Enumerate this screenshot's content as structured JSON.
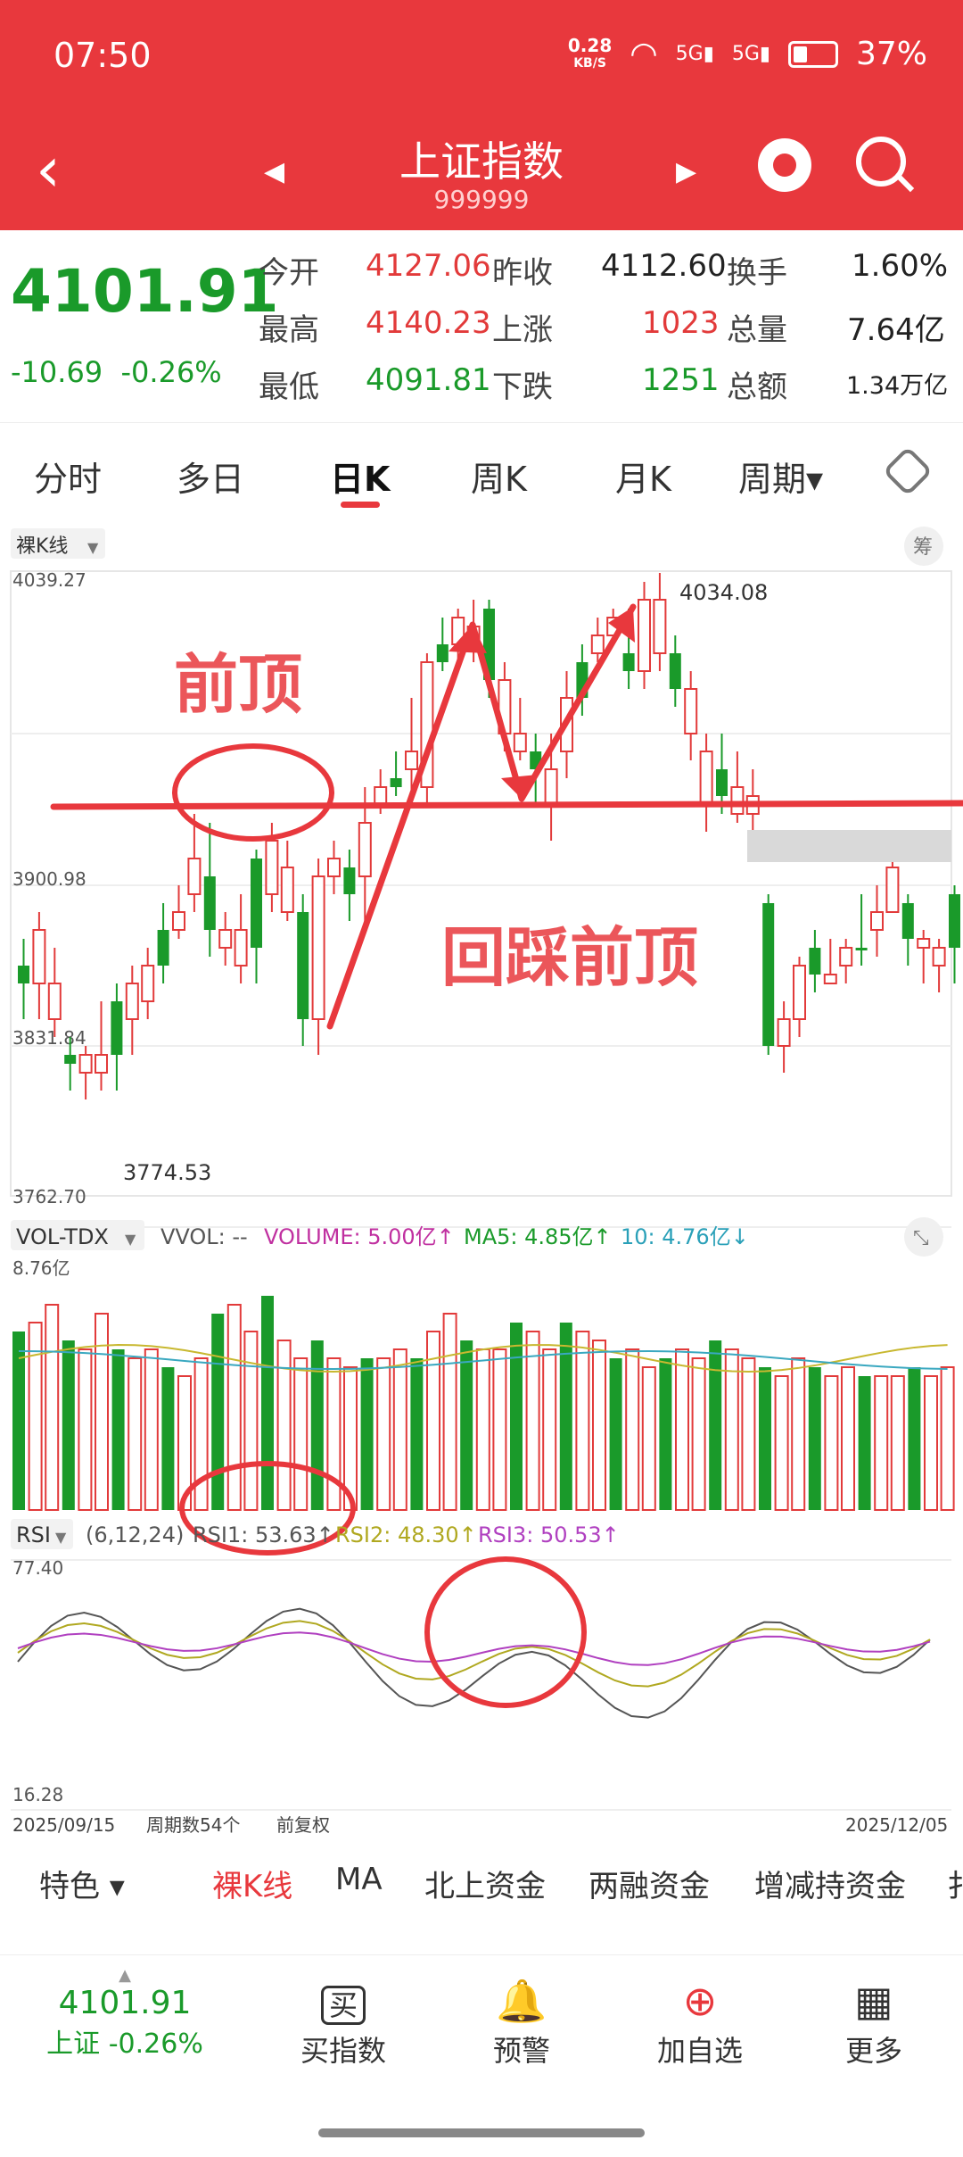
{
  "status": {
    "time": "07:50",
    "net_speed": "0.28",
    "net_unit": "KB/S",
    "signal1": "5G",
    "signal2": "5G",
    "battery": "37%"
  },
  "header": {
    "title": "上证指数",
    "code": "999999"
  },
  "quote": {
    "price": "4101.91",
    "change": "-10.69",
    "change_pct": "-0.26%",
    "rows": [
      {
        "l1": "今开",
        "v1": "4127.06",
        "l2": "昨收",
        "v2": "4112.60",
        "l3": "换手",
        "v3": "1.60%"
      },
      {
        "l1": "最高",
        "v1": "4140.23",
        "l2": "上涨",
        "v2": "1023",
        "l3": "总量",
        "v3": "7.64亿"
      },
      {
        "l1": "最低",
        "v1": "4091.81",
        "l2": "下跌",
        "v2": "1251",
        "l3": "总额",
        "v3": "1.34万亿"
      }
    ]
  },
  "tabs": [
    "分时",
    "多日",
    "日K",
    "周K",
    "月K",
    "周期▾"
  ],
  "kline": {
    "mode_label": "裸K线",
    "chip_label": "筹",
    "y_labels": [
      "4039.27",
      "3900.98",
      "3831.84",
      "3762.70"
    ],
    "high_label": "4034.08",
    "low_label": "3774.53",
    "annotation1": "前顶",
    "annotation2": "回踩前顶"
  },
  "volume": {
    "label": "VOL-TDX",
    "vvol": "VVOL: --",
    "volume": "VOLUME: 5.00亿↑",
    "ma5": "MA5: 4.85亿↑",
    "ma10": "10: 4.76亿↓",
    "max_label": "8.76亿"
  },
  "rsi": {
    "label": "RSI",
    "params": "(6,12,24)",
    "rsi1": "RSI1: 53.63↑",
    "rsi2": "RSI2: 48.30↑",
    "rsi3": "RSI3: 50.53↑",
    "top": "77.40",
    "bottom": "16.28"
  },
  "axis": {
    "start": "2025/09/15",
    "periods": "周期数54个",
    "adjust": "前复权",
    "end": "2025/12/05"
  },
  "bottom_tabs": [
    "特色 ▾",
    "裸K线",
    "MA",
    "北上资金",
    "两融资金",
    "增减持资金",
    "扌"
  ],
  "nav": {
    "price": "4101.91",
    "sub": "上证 -0.26%",
    "items": [
      {
        "icon": "买",
        "label": "买指数"
      },
      {
        "icon": "🔔",
        "label": "预警"
      },
      {
        "icon": "⊕",
        "label": "加自选"
      },
      {
        "icon": "▦",
        "label": "更多"
      }
    ]
  },
  "colors": {
    "brand": "#e8383d",
    "up": "#e23a3a",
    "down": "#1a9a2a",
    "ma5": "#c8b830",
    "ma10": "#3aa8c0",
    "rsi3": "#b040c0"
  }
}
